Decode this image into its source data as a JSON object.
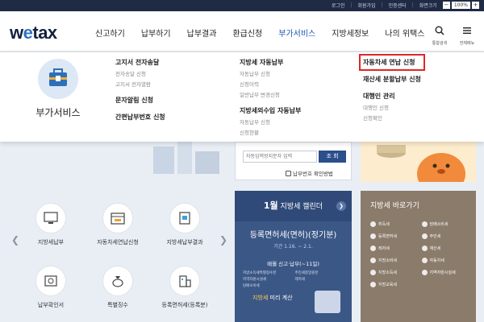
{
  "util": {
    "login": "로그인",
    "join": "회원가입",
    "cert": "인증센터",
    "screen_size": "화면크기",
    "minus": "−",
    "zoom": "100%",
    "plus": "+"
  },
  "logo": {
    "pre": "w",
    "mid": "e",
    "post": "tax"
  },
  "gnb": [
    "신고하기",
    "납부하기",
    "납부결과",
    "환급신청",
    "부가서비스",
    "지방세정보",
    "나의 위택스"
  ],
  "header_buttons": {
    "search": "통합검색",
    "menu": "전체메뉴"
  },
  "mega": {
    "title": "부가서비스",
    "col1": [
      {
        "h": "고지서 전자송달",
        "subs": [
          "전자송달 신청",
          "고지서 전자열람"
        ]
      },
      {
        "h": "문자알림 신청",
        "subs": []
      },
      {
        "h": "간편납부번호 신청",
        "subs": []
      }
    ],
    "col2": [
      {
        "h": "지방세 자동납부",
        "subs": [
          "자동납부 신청",
          "신청이력",
          "일반납부 변경신청"
        ]
      },
      {
        "h": "지방세외수입 자동납부",
        "subs": [
          "자동납부 신청",
          "신청현황"
        ]
      }
    ],
    "col3": [
      {
        "h": "자동차세 연납 신청",
        "subs": []
      },
      {
        "h": "재산세 분할납부 신청",
        "subs": []
      },
      {
        "h": "대행인 관리",
        "subs": [
          "대행인 신청",
          "신청확인"
        ]
      }
    ]
  },
  "lookup": {
    "placeholder": "자동입력방지문자 입력",
    "button": "조 회",
    "link": "납부번호 확인방법"
  },
  "shortcuts": [
    "지방세납부",
    "자동차세연납신청",
    "지방세납부결과",
    "납부확인서",
    "특별징수",
    "등록면허세(등록분)"
  ],
  "calendar": {
    "month": "1월",
    "head": "지방세 캘린더",
    "title": "등록면허세(면허)(정기분)",
    "period": "기간 1.16. ~ 2.1.",
    "sub": "매월 신고·납부(~11일)",
    "items": [
      "지방소득세특별징수분",
      "주민세종업원분",
      "지역자원시설세",
      "레저세",
      "담배소비세"
    ],
    "foot_highlight": "지방세",
    "foot_rest": " 미리 계산"
  },
  "quick": {
    "title": "지방세 바로가기",
    "items": [
      "취득세",
      "담배소비세",
      "등록면허세",
      "주민세",
      "레저세",
      "재산세",
      "지방소비세",
      "자동차세",
      "지방소득세",
      "지역자원시설세",
      "지방교육세"
    ]
  },
  "colors": {
    "nav_active": "#1b57b2",
    "highlight": "#e02525",
    "calendar": "#3b5786",
    "quick": "#8a7b6b"
  }
}
